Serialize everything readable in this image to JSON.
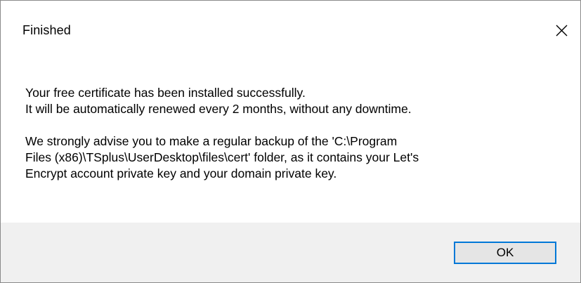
{
  "window": {
    "title": "Finished",
    "close_icon": "close-icon"
  },
  "message": {
    "line1": "Your free certificate has been installed successfully.",
    "line2": "It will be automatically renewed every 2 months, without any downtime.",
    "para2_line1": "We strongly advise you to make a regular backup of the 'C:\\Program",
    "para2_line2": "Files (x86)\\TSplus\\UserDesktop\\files\\cert' folder, as it contains your Let's",
    "para2_line3": "Encrypt account private key and your domain private key."
  },
  "buttons": {
    "ok_label": "OK"
  },
  "colors": {
    "accent": "#0078d7",
    "footer_bg": "#f0f0f0",
    "button_bg": "#e5e5e5"
  }
}
